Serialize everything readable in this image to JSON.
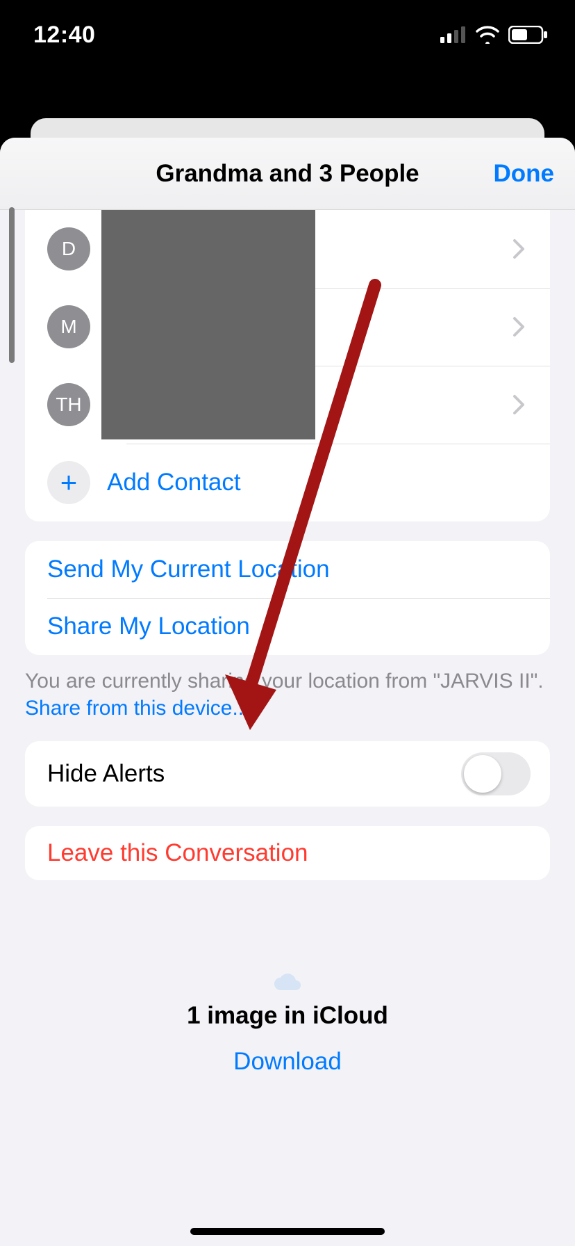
{
  "status": {
    "time": "12:40"
  },
  "header": {
    "title": "Grandma and 3 People",
    "done": "Done"
  },
  "contacts": [
    {
      "initials": "D"
    },
    {
      "initials": "M"
    },
    {
      "initials": "TH"
    }
  ],
  "add_contact": {
    "label": "Add Contact"
  },
  "location": {
    "send": "Send My Current Location",
    "share": "Share My Location",
    "note_prefix": "You are currently sharing your location from \"JARVIS II\". ",
    "note_link": "Share from this device...",
    "note_suffix": ""
  },
  "alerts": {
    "label": "Hide Alerts",
    "on": false
  },
  "leave": {
    "label": "Leave this Conversation"
  },
  "icloud": {
    "title": "1 image in iCloud",
    "download": "Download"
  }
}
